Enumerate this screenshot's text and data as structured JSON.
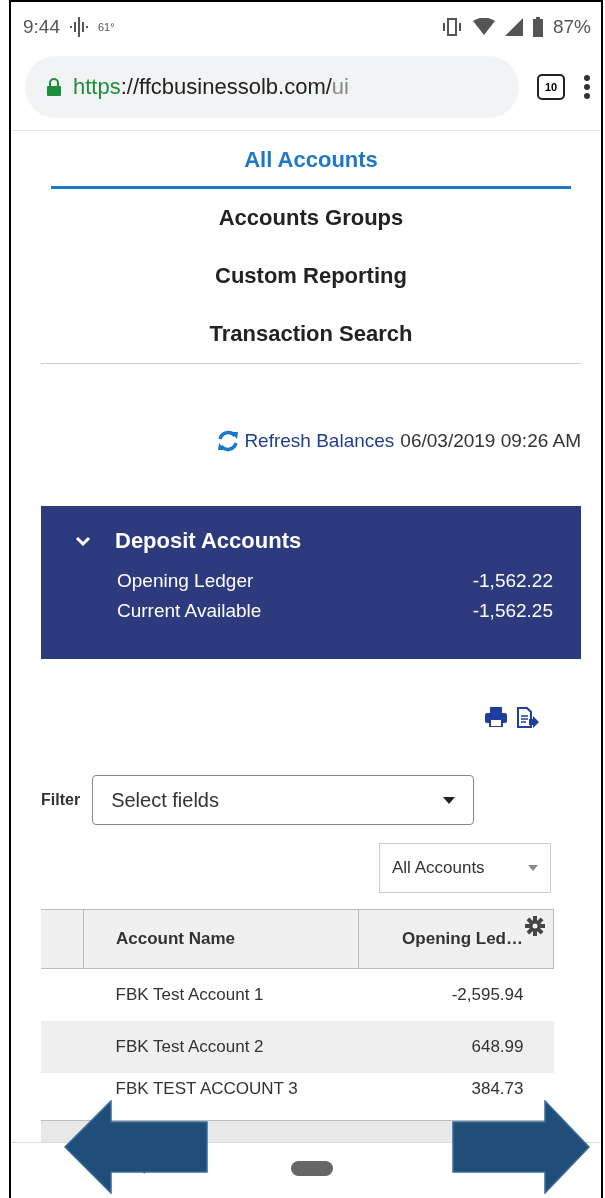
{
  "status_bar": {
    "time": "9:44",
    "temperature": "61°",
    "battery": "87%"
  },
  "browser": {
    "url_scheme": "https",
    "url_host": "://ffcbusinessolb.com/",
    "url_path": "ui",
    "tab_count": "10"
  },
  "tabs": [
    {
      "label": "All Accounts",
      "selected": true
    },
    {
      "label": "Accounts Groups",
      "selected": false
    },
    {
      "label": "Custom Reporting",
      "selected": false
    },
    {
      "label": "Transaction Search",
      "selected": false
    }
  ],
  "refresh": {
    "label": "Refresh Balances",
    "timestamp": "06/03/2019 09:26 AM"
  },
  "summary": {
    "title": "Deposit Accounts",
    "expanded": true,
    "lines": [
      {
        "label": "Opening Ledger",
        "value": "-1,562.22"
      },
      {
        "label": "Current Available",
        "value": "-1,562.25"
      }
    ]
  },
  "filter": {
    "label": "Filter",
    "placeholder": "Select fields"
  },
  "account_scope": {
    "value": "All Accounts"
  },
  "table": {
    "columns": [
      "Account Name",
      "Opening Led…"
    ],
    "rows": [
      {
        "name": "FBK Test Account 1",
        "opening": "-2,595.94"
      },
      {
        "name": "FBK Test Account 2",
        "opening": "648.99"
      },
      {
        "name": "FBK TEST ACCOUNT 3",
        "opening": "384.73"
      }
    ]
  }
}
